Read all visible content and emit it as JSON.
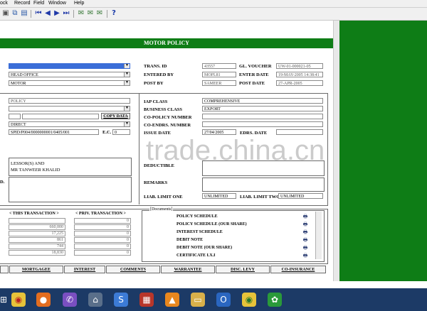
{
  "menu": {
    "items": [
      "ock",
      "Record",
      "Field",
      "Window",
      "Help"
    ]
  },
  "toolbar": {
    "icons": [
      "save-icon",
      "copy-icon",
      "paste-icon",
      "first-record-icon",
      "prev-record-icon",
      "next-record-icon",
      "last-record-icon",
      "mail-icon",
      "mail-send-icon",
      "mail-open-icon",
      "help-icon"
    ],
    "help_glyph": "?"
  },
  "form": {
    "title": "MOTOR POLICY",
    "left": {
      "head_office": "HEAD OFFICE",
      "motor": "MOTOR",
      "policy": "POLICY",
      "direct": "DIRECT",
      "policy_number": "SPID/P004/0000000001/0405/001",
      "copy_data": "COPY DATA",
      "ec_label": "E.C.",
      "ec_value": "0",
      "lessor_line1": "LESSOR(S) AND",
      "lessor_line2": "MR TANWEER KHALID",
      "d_label": "D."
    },
    "right_top": {
      "trans_id_label": "TRANS. ID",
      "trans_id": "43557",
      "gl_voucher_label": "GL. VOUCHER",
      "gl_voucher": "UW-01-000021-05",
      "entered_by_label": "ENTERED BY",
      "entered_by": "MOPL81",
      "enter_date_label": "ENTER DATE",
      "enter_date": "19-MAY-2005 14:38:41",
      "post_by_label": "POST BY",
      "post_by": "SAMEER",
      "post_date_label": "POST DATE",
      "post_date": "27-APR-2005"
    },
    "right_mid": {
      "iap_class_label": "IAP CLASS",
      "iap_class": "COMPREHENSIVE",
      "business_class_label": "BUSINESS CLASS",
      "business_class": "EXPORT",
      "co_policy_label": "CO-POLICY NUMBER",
      "co_endrs_label": "CO-ENDRS. NUMBER",
      "issue_date_label": "ISSUE DATE",
      "issue_date": "27/04/2005",
      "edrs_date_label": "EDRS. DATE",
      "deductible_label": "DEDUCTIBLE",
      "remarks_label": "REMARKS",
      "liab_one_label": "LIAB. LIMIT ONE",
      "liab_one": "UNLIMITED",
      "liab_two_label": "LIAB. LIMIT TWO",
      "liab_two": "UNLIMITED"
    },
    "transactions": {
      "this_header": "< THIS TRANSACTION >",
      "prev_header": "< PRIV. TRANSACTION >",
      "this_values": [
        "",
        "660,000",
        "17,225",
        "861",
        "744",
        "18,830"
      ],
      "prev_values": [
        "0",
        "0",
        "0",
        "0",
        "0",
        "0"
      ]
    },
    "documents": {
      "header": "[Documents]",
      "items": [
        "POLICY SCHEDULE",
        "POLICY SCHEDULE (OUR SHARE)",
        "INTEREST SCHEDULE",
        "DEBIT NOTE",
        "DEBIT NOTE (OUR SHARE)",
        "CERTIFICATE I.X.I"
      ]
    },
    "tabs": [
      "MORTGAGEE",
      "INTEREST",
      "COMMENTS",
      "WARRANTEE",
      "DISC. LEVY",
      "CO-INSURANCE"
    ]
  },
  "watermark": "trade.china.cn",
  "taskbar": {
    "icons": [
      "windows-start-icon",
      "chrome-icon",
      "firefox-icon",
      "viber-icon",
      "network-icon",
      "skype-icon",
      "oracle-icon",
      "vlc-icon",
      "folder-icon",
      "outlook-icon",
      "chrome-alt-icon",
      "green-app-icon"
    ]
  },
  "colors": {
    "green": "#0e7d16",
    "taskbar": "#1c3a66"
  }
}
